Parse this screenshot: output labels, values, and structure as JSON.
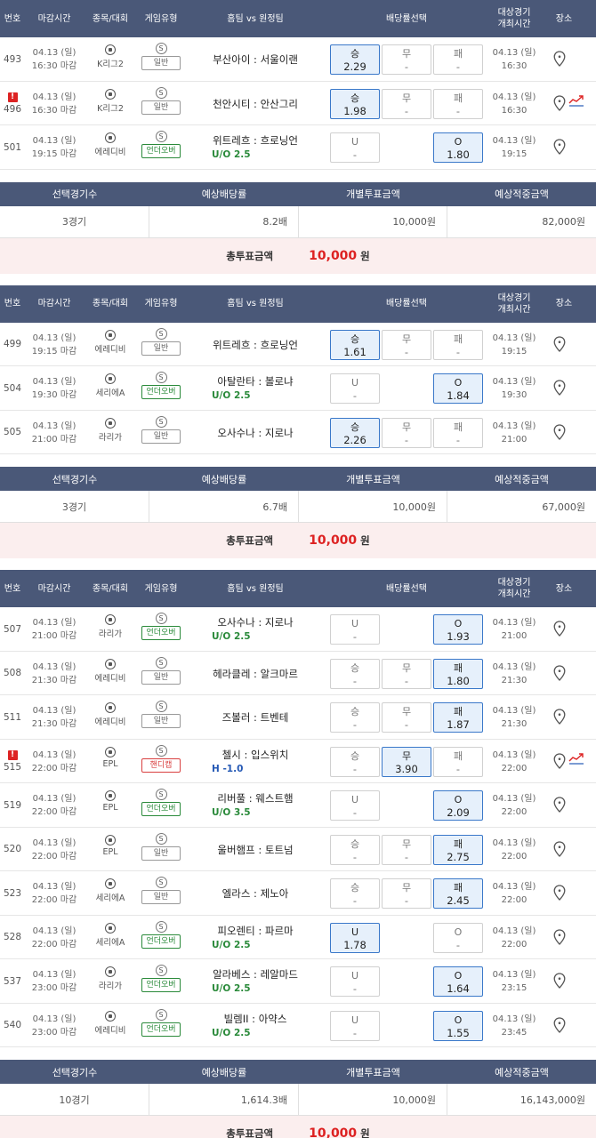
{
  "headers": {
    "no": "번호",
    "deadline": "마감시간",
    "sport": "종목/대회",
    "gametype": "게임유형",
    "match": "홈팀 vs 원정팀",
    "odds": "배당률선택",
    "start1": "대상경기",
    "start2": "개최시간",
    "location": "장소"
  },
  "summary_headers": {
    "count": "선택경기수",
    "odds": "예상배당률",
    "stake": "개별투표금액",
    "payout": "예상적중금액"
  },
  "total_label": "총투표금액",
  "total_unit": "원",
  "slips": [
    {
      "rows": [
        {
          "no": "493",
          "alert": false,
          "date": "04.13 (일)",
          "deadline": "16:30 마감",
          "league": "K리그2",
          "type": "일반",
          "typeClass": "",
          "match": "부산아이 : 서울이랜",
          "sub": "",
          "subClass": "",
          "opts": [
            {
              "l": "승",
              "o": "2.29",
              "s": true
            },
            {
              "l": "무",
              "o": "-",
              "s": false
            },
            {
              "l": "패",
              "o": "-",
              "s": false
            }
          ],
          "sdate": "04.13 (일)",
          "stime": "16:30",
          "trend": false
        },
        {
          "no": "496",
          "alert": true,
          "date": "04.13 (일)",
          "deadline": "16:30 마감",
          "league": "K리그2",
          "type": "일반",
          "typeClass": "",
          "match": "천안시티 : 안산그리",
          "sub": "",
          "subClass": "",
          "opts": [
            {
              "l": "승",
              "o": "1.98",
              "s": true
            },
            {
              "l": "무",
              "o": "-",
              "s": false
            },
            {
              "l": "패",
              "o": "-",
              "s": false
            }
          ],
          "sdate": "04.13 (일)",
          "stime": "16:30",
          "trend": true
        },
        {
          "no": "501",
          "alert": false,
          "date": "04.13 (일)",
          "deadline": "19:15 마감",
          "league": "에레디비",
          "type": "언더오버",
          "typeClass": "ou",
          "match": "위트레흐 : 흐로닝언",
          "sub": "U/O 2.5",
          "subClass": "",
          "opts": [
            {
              "l": "U",
              "o": "-",
              "s": false
            },
            null,
            {
              "l": "O",
              "o": "1.80",
              "s": true
            }
          ],
          "sdate": "04.13 (일)",
          "stime": "19:15",
          "trend": false
        }
      ],
      "summary": {
        "count": "3경기",
        "odds": "8.2배",
        "stake": "10,000원",
        "payout": "82,000원"
      },
      "total": "10,000"
    },
    {
      "rows": [
        {
          "no": "499",
          "alert": false,
          "date": "04.13 (일)",
          "deadline": "19:15 마감",
          "league": "에레디비",
          "type": "일반",
          "typeClass": "",
          "match": "위트레흐 : 흐로닝언",
          "sub": "",
          "subClass": "",
          "opts": [
            {
              "l": "승",
              "o": "1.61",
              "s": true
            },
            {
              "l": "무",
              "o": "-",
              "s": false
            },
            {
              "l": "패",
              "o": "-",
              "s": false
            }
          ],
          "sdate": "04.13 (일)",
          "stime": "19:15",
          "trend": false
        },
        {
          "no": "504",
          "alert": false,
          "date": "04.13 (일)",
          "deadline": "19:30 마감",
          "league": "세리에A",
          "type": "언더오버",
          "typeClass": "ou",
          "match": "아탈란타 : 볼로냐",
          "sub": "U/O 2.5",
          "subClass": "",
          "opts": [
            {
              "l": "U",
              "o": "-",
              "s": false
            },
            null,
            {
              "l": "O",
              "o": "1.84",
              "s": true
            }
          ],
          "sdate": "04.13 (일)",
          "stime": "19:30",
          "trend": false
        },
        {
          "no": "505",
          "alert": false,
          "date": "04.13 (일)",
          "deadline": "21:00 마감",
          "league": "라리가",
          "type": "일반",
          "typeClass": "",
          "match": "오사수나 : 지로나",
          "sub": "",
          "subClass": "",
          "opts": [
            {
              "l": "승",
              "o": "2.26",
              "s": true
            },
            {
              "l": "무",
              "o": "-",
              "s": false
            },
            {
              "l": "패",
              "o": "-",
              "s": false
            }
          ],
          "sdate": "04.13 (일)",
          "stime": "21:00",
          "trend": false
        }
      ],
      "summary": {
        "count": "3경기",
        "odds": "6.7배",
        "stake": "10,000원",
        "payout": "67,000원"
      },
      "total": "10,000"
    },
    {
      "rows": [
        {
          "no": "507",
          "alert": false,
          "date": "04.13 (일)",
          "deadline": "21:00 마감",
          "league": "라리가",
          "type": "언더오버",
          "typeClass": "ou",
          "match": "오사수나 : 지로나",
          "sub": "U/O 2.5",
          "subClass": "",
          "opts": [
            {
              "l": "U",
              "o": "-",
              "s": false
            },
            null,
            {
              "l": "O",
              "o": "1.93",
              "s": true
            }
          ],
          "sdate": "04.13 (일)",
          "stime": "21:00",
          "trend": false
        },
        {
          "no": "508",
          "alert": false,
          "date": "04.13 (일)",
          "deadline": "21:30 마감",
          "league": "에레디비",
          "type": "일반",
          "typeClass": "",
          "match": "헤라클레 : 알크마르",
          "sub": "",
          "subClass": "",
          "opts": [
            {
              "l": "승",
              "o": "-",
              "s": false
            },
            {
              "l": "무",
              "o": "-",
              "s": false
            },
            {
              "l": "패",
              "o": "1.80",
              "s": true
            }
          ],
          "sdate": "04.13 (일)",
          "stime": "21:30",
          "trend": false
        },
        {
          "no": "511",
          "alert": false,
          "date": "04.13 (일)",
          "deadline": "21:30 마감",
          "league": "에레디비",
          "type": "일반",
          "typeClass": "",
          "match": "즈볼러 : 트벤테",
          "sub": "",
          "subClass": "",
          "opts": [
            {
              "l": "승",
              "o": "-",
              "s": false
            },
            {
              "l": "무",
              "o": "-",
              "s": false
            },
            {
              "l": "패",
              "o": "1.87",
              "s": true
            }
          ],
          "sdate": "04.13 (일)",
          "stime": "21:30",
          "trend": false
        },
        {
          "no": "515",
          "alert": true,
          "date": "04.13 (일)",
          "deadline": "22:00 마감",
          "league": "EPL",
          "type": "핸디캡",
          "typeClass": "hc",
          "match": "첼시 : 입스위치",
          "sub": "H -1.0",
          "subClass": "hc",
          "opts": [
            {
              "l": "승",
              "o": "-",
              "s": false
            },
            {
              "l": "무",
              "o": "3.90",
              "s": true
            },
            {
              "l": "패",
              "o": "-",
              "s": false
            }
          ],
          "sdate": "04.13 (일)",
          "stime": "22:00",
          "trend": true
        },
        {
          "no": "519",
          "alert": false,
          "date": "04.13 (일)",
          "deadline": "22:00 마감",
          "league": "EPL",
          "type": "언더오버",
          "typeClass": "ou",
          "match": "리버풀 : 웨스트햄",
          "sub": "U/O 3.5",
          "subClass": "",
          "opts": [
            {
              "l": "U",
              "o": "-",
              "s": false
            },
            null,
            {
              "l": "O",
              "o": "2.09",
              "s": true
            }
          ],
          "sdate": "04.13 (일)",
          "stime": "22:00",
          "trend": false
        },
        {
          "no": "520",
          "alert": false,
          "date": "04.13 (일)",
          "deadline": "22:00 마감",
          "league": "EPL",
          "type": "일반",
          "typeClass": "",
          "match": "울버햄프 : 토트넘",
          "sub": "",
          "subClass": "",
          "opts": [
            {
              "l": "승",
              "o": "-",
              "s": false
            },
            {
              "l": "무",
              "o": "-",
              "s": false
            },
            {
              "l": "패",
              "o": "2.75",
              "s": true
            }
          ],
          "sdate": "04.13 (일)",
          "stime": "22:00",
          "trend": false
        },
        {
          "no": "523",
          "alert": false,
          "date": "04.13 (일)",
          "deadline": "22:00 마감",
          "league": "세리에A",
          "type": "일반",
          "typeClass": "",
          "match": "엘라스 : 제노아",
          "sub": "",
          "subClass": "",
          "opts": [
            {
              "l": "승",
              "o": "-",
              "s": false
            },
            {
              "l": "무",
              "o": "-",
              "s": false
            },
            {
              "l": "패",
              "o": "2.45",
              "s": true
            }
          ],
          "sdate": "04.13 (일)",
          "stime": "22:00",
          "trend": false
        },
        {
          "no": "528",
          "alert": false,
          "date": "04.13 (일)",
          "deadline": "22:00 마감",
          "league": "세리에A",
          "type": "언더오버",
          "typeClass": "ou",
          "match": "피오렌티 : 파르마",
          "sub": "U/O 2.5",
          "subClass": "",
          "opts": [
            {
              "l": "U",
              "o": "1.78",
              "s": true
            },
            null,
            {
              "l": "O",
              "o": "-",
              "s": false
            }
          ],
          "sdate": "04.13 (일)",
          "stime": "22:00",
          "trend": false
        },
        {
          "no": "537",
          "alert": false,
          "date": "04.13 (일)",
          "deadline": "23:00 마감",
          "league": "라리가",
          "type": "언더오버",
          "typeClass": "ou",
          "match": "알라베스 : 레알마드",
          "sub": "U/O 2.5",
          "subClass": "",
          "opts": [
            {
              "l": "U",
              "o": "-",
              "s": false
            },
            null,
            {
              "l": "O",
              "o": "1.64",
              "s": true
            }
          ],
          "sdate": "04.13 (일)",
          "stime": "23:15",
          "trend": false
        },
        {
          "no": "540",
          "alert": false,
          "date": "04.13 (일)",
          "deadline": "23:00 마감",
          "league": "에레디비",
          "type": "언더오버",
          "typeClass": "ou",
          "match": "빌렘II : 아약스",
          "sub": "U/O 2.5",
          "subClass": "",
          "opts": [
            {
              "l": "U",
              "o": "-",
              "s": false
            },
            null,
            {
              "l": "O",
              "o": "1.55",
              "s": true
            }
          ],
          "sdate": "04.13 (일)",
          "stime": "23:45",
          "trend": false
        }
      ],
      "summary": {
        "count": "10경기",
        "odds": "1,614.3배",
        "stake": "10,000원",
        "payout": "16,143,000원"
      },
      "total": "10,000"
    }
  ]
}
